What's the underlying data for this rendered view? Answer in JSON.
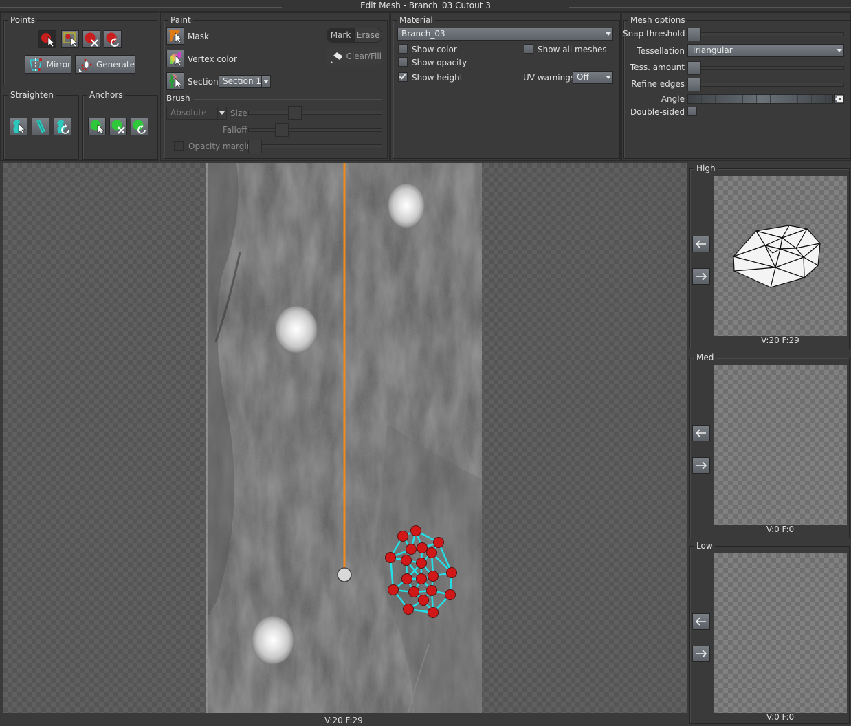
{
  "window": {
    "title": "Edit Mesh - Branch_03 Cutout 3"
  },
  "points": {
    "legend": "Points",
    "tools": [
      {
        "name": "select-point",
        "icon": "red-point-cursor-icon",
        "active": true
      },
      {
        "name": "box-select-point",
        "icon": "box-select-cursor-icon",
        "active": false
      },
      {
        "name": "delete-point",
        "icon": "red-point-delete-icon",
        "active": false
      },
      {
        "name": "reset-point",
        "icon": "red-point-reset-icon",
        "active": false
      }
    ],
    "mirror_label": "Mirror",
    "generate_label": "Generate"
  },
  "straighten": {
    "legend": "Straighten"
  },
  "anchors": {
    "legend": "Anchors"
  },
  "paint": {
    "legend": "Paint",
    "mask_label": "Mask",
    "vertex_color_label": "Vertex color",
    "section_label": "Section",
    "section_value": "Section 1",
    "mark_label": "Mark",
    "erase_label": "Erase",
    "clear_fill_label": "Clear/Fill",
    "brush_label": "Brush",
    "brush_mode": "Absolute",
    "size_label": "Size",
    "size_value": 0.33,
    "falloff_label": "Falloff",
    "falloff_value": 0.22,
    "opacity_margin_label": "Opacity margin",
    "opacity_margin_checked": false,
    "opacity_margin_value": 0.0
  },
  "material": {
    "legend": "Material",
    "value": "Branch_03",
    "show_color_label": "Show color",
    "show_color": false,
    "show_opacity_label": "Show opacity",
    "show_opacity": false,
    "show_height_label": "Show height",
    "show_height": true,
    "show_all_meshes_label": "Show all meshes",
    "show_all_meshes": false,
    "uv_warnings_label": "UV warnings",
    "uv_warnings_value": "Off"
  },
  "mesh_options": {
    "legend": "Mesh options",
    "snap_threshold_label": "Snap threshold",
    "snap_threshold": 0.0,
    "tessellation_label": "Tessellation",
    "tessellation_value": "Triangular",
    "tess_amount_label": "Tess. amount",
    "tess_amount": 0.0,
    "refine_edges_label": "Refine edges",
    "refine_edges": 0.0,
    "angle_label": "Angle",
    "double_sided_label": "Double-sided",
    "double_sided": false
  },
  "viewport": {
    "stats": "V:20  F:29"
  },
  "lods": [
    {
      "legend": "High",
      "stats": "V:20  F:29"
    },
    {
      "legend": "Med",
      "stats": "V:0  F:0"
    },
    {
      "legend": "Low",
      "stats": "V:0  F:0"
    }
  ],
  "colors": {
    "point": "#d01818",
    "edge": "#22e0e8",
    "axis": "#f08a1c",
    "anchor": "#2ec83a",
    "teal": "#2cc8bc"
  }
}
